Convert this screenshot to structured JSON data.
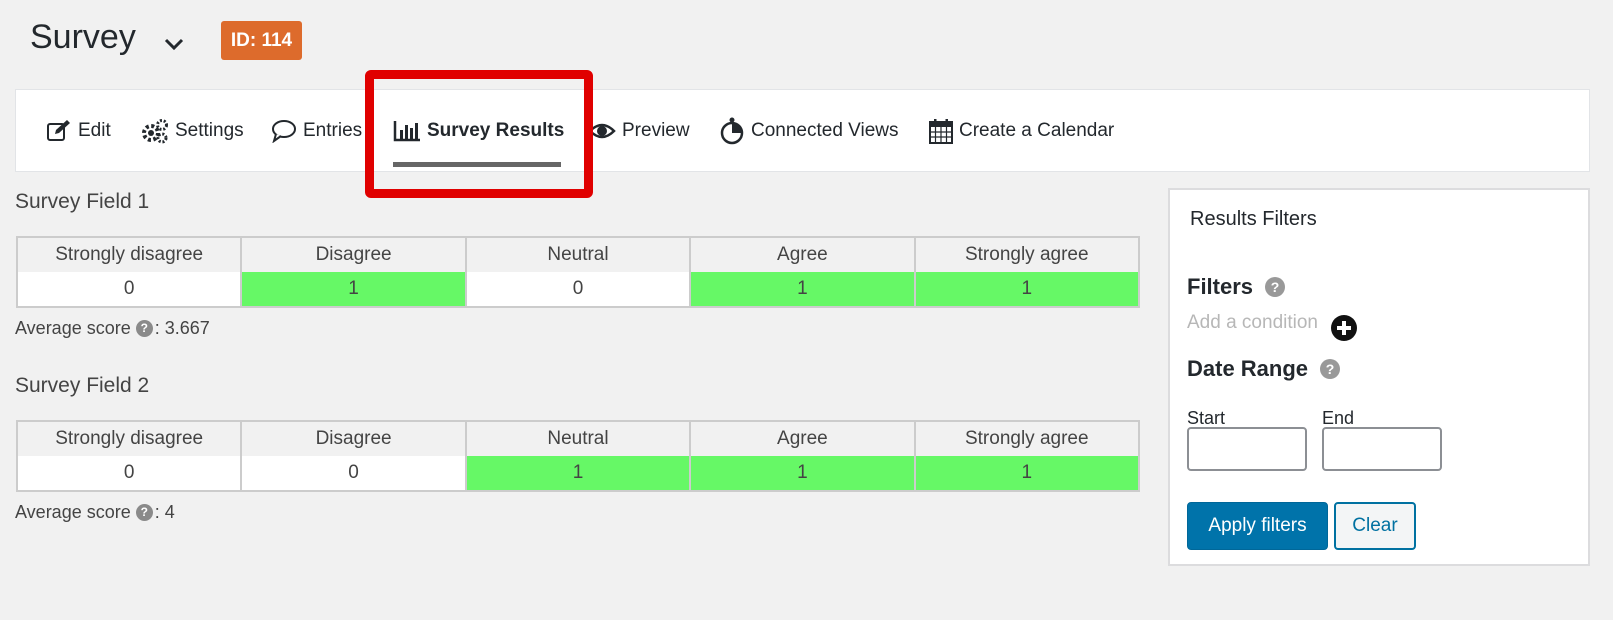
{
  "header": {
    "title": "Survey",
    "dropdown_icon": "chevron-down-icon",
    "id_badge": "ID: 114",
    "badge_color": "#dd6b2c"
  },
  "nav": {
    "items": [
      {
        "label": "Edit",
        "icon": "edit-icon"
      },
      {
        "label": "Settings",
        "icon": "gears-icon"
      },
      {
        "label": "Entries",
        "icon": "comment-icon"
      },
      {
        "label": "Survey Results",
        "icon": "bar-chart-icon",
        "active": true
      },
      {
        "label": "Preview",
        "icon": "eye-icon"
      },
      {
        "label": "Connected Views",
        "icon": "connected-views-icon"
      },
      {
        "label": "Create a Calendar",
        "icon": "calendar-icon"
      }
    ],
    "highlight_color": "#e00000"
  },
  "fields": [
    {
      "title": "Survey Field 1",
      "columns": [
        "Strongly disagree",
        "Disagree",
        "Neutral",
        "Agree",
        "Strongly agree"
      ],
      "counts": [
        "0",
        "1",
        "0",
        "1",
        "1"
      ],
      "average_label": "Average score",
      "average_value": ": 3.667"
    },
    {
      "title": "Survey Field 2",
      "columns": [
        "Strongly disagree",
        "Disagree",
        "Neutral",
        "Agree",
        "Strongly agree"
      ],
      "counts": [
        "0",
        "0",
        "1",
        "1",
        "1"
      ],
      "average_label": "Average score",
      "average_value": ": 4"
    }
  ],
  "highlight_cell_color": "#66f866",
  "filters_panel": {
    "title": "Results Filters",
    "filters_heading": "Filters",
    "add_condition": "Add a condition",
    "date_range_heading": "Date Range",
    "start_label": "Start",
    "end_label": "End",
    "start_value": "",
    "end_value": "",
    "apply_label": "Apply filters",
    "clear_label": "Clear"
  },
  "colors": {
    "primary_button": "#0073aa",
    "background": "#f1f1f1"
  }
}
